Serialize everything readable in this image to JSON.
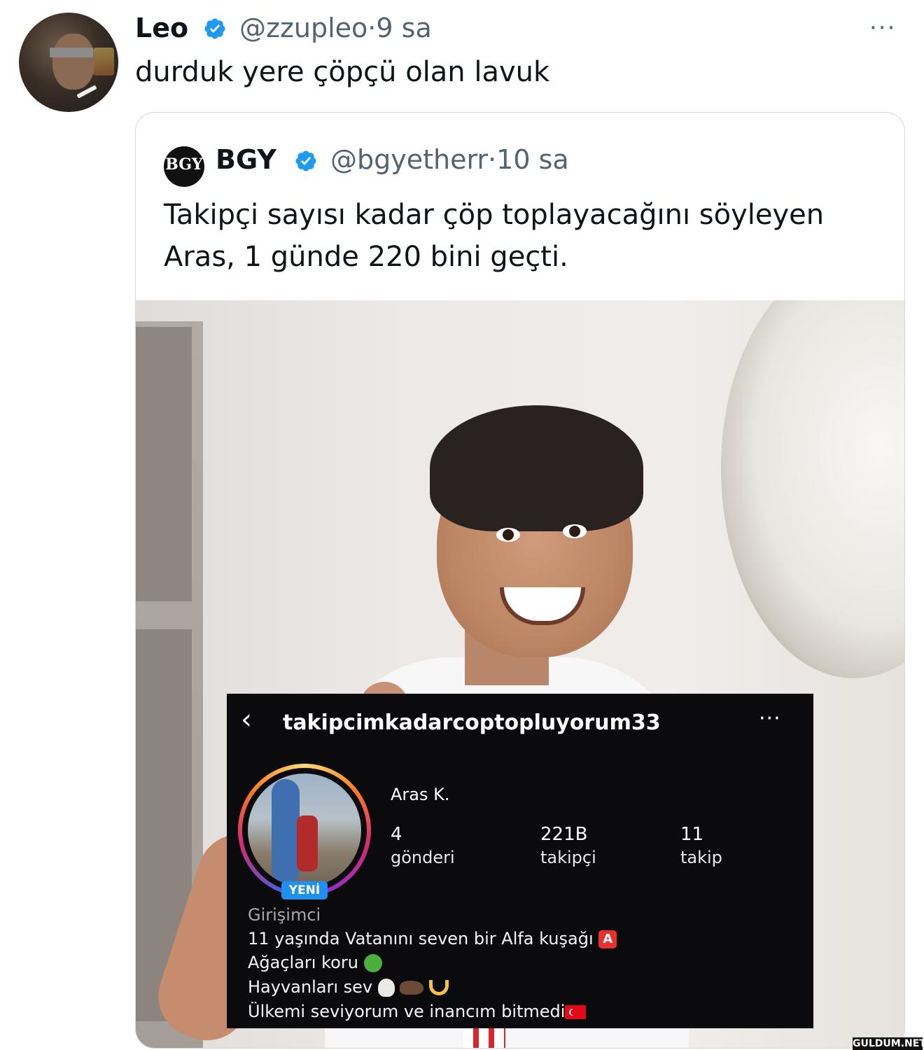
{
  "outer_tweet": {
    "display_name": "Leo",
    "handle": "@zzupleo",
    "separator": "·",
    "time": "9 sa",
    "text": "durduk yere çöpçü olan lavuk",
    "more_icon": "···"
  },
  "quoted_tweet": {
    "avatar_text": "BGY",
    "display_name": "BGY",
    "handle": "@bgyetherr",
    "separator": "·",
    "time": "10 sa",
    "text": "Takipçi sayısı kadar çöp toplayacağını söyleyen Aras, 1 günde 220 bini geçti."
  },
  "instagram_profile": {
    "back_icon": "‹",
    "username": "takipcimkadarcoptopluyorum33",
    "more_icon": "···",
    "new_badge": "YENİ",
    "full_name": "Aras K.",
    "stats": [
      {
        "value": "4",
        "label": "gönderi"
      },
      {
        "value": "221B",
        "label": "takipçi"
      },
      {
        "value": "11",
        "label": "takip"
      }
    ],
    "category": "Girişimci",
    "bio_lines": [
      "11 yaşında Vatanını seven bir Alfa kuşağı",
      "Ağaçları koru",
      "Hayvanları sev",
      "Ülkemi seviyorum ve inancım bitmedi"
    ]
  },
  "watermark": "GULDUM.NET",
  "colors": {
    "text_primary": "#0f1419",
    "text_secondary": "#536471",
    "verified_blue": "#1d9bf0",
    "card_border": "#cfd9de",
    "ig_background": "#0b0b0d"
  }
}
